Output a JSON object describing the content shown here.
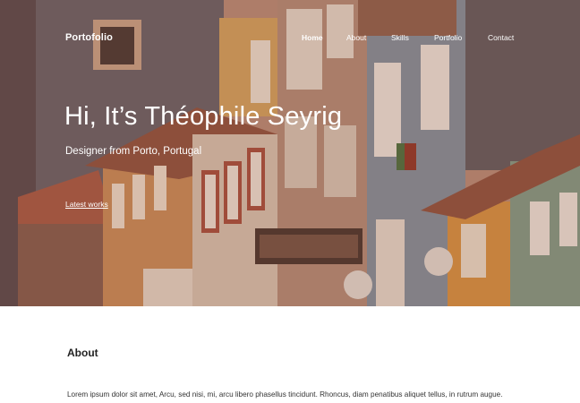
{
  "site": {
    "logo": "Portofolio"
  },
  "nav": {
    "items": [
      {
        "label": "Home",
        "active": true
      },
      {
        "label": "About",
        "active": false
      },
      {
        "label": "Skills",
        "active": false
      },
      {
        "label": "Portfolio",
        "active": false
      },
      {
        "label": "Contact",
        "active": false
      }
    ]
  },
  "hero": {
    "title": "Hi, It’s Théophile Seyrig",
    "subtitle": "Designer from Porto, Portugal",
    "link": "Latest works",
    "image": "porto-houses-facade"
  },
  "about": {
    "heading": "About",
    "text": "Lorem ipsum dolor sit amet, Arcu, sed nisi, mi, arcu libero phasellus tincidunt. Rhoncus, diam penatibus aliquet tellus, in rutrum augue."
  },
  "colors": {
    "hero_text": "#ffffff",
    "body_text": "#222222",
    "background": "#ffffff"
  }
}
